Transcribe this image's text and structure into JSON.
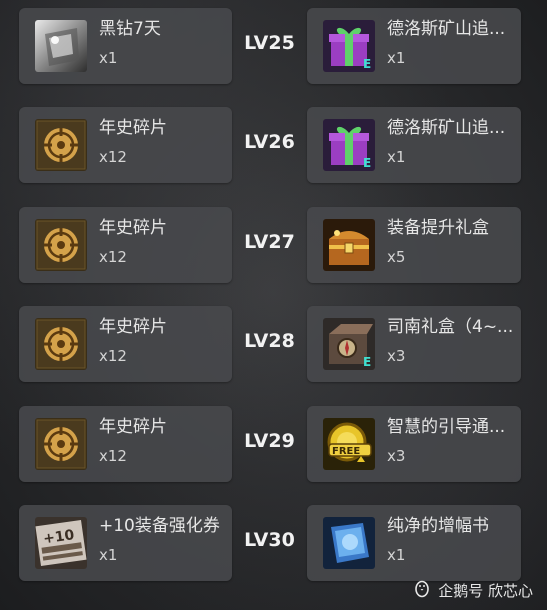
{
  "rows": [
    {
      "level": "LV25",
      "left": {
        "name": "黑钻7天",
        "qty": "x1",
        "icon": "black-diamond-icon"
      },
      "right": {
        "name": "德洛斯矿山追...",
        "qty": "x1",
        "icon": "gift-box-icon"
      }
    },
    {
      "level": "LV26",
      "left": {
        "name": "年史碎片",
        "qty": "x12",
        "icon": "chronicle-fragment-icon"
      },
      "right": {
        "name": "德洛斯矿山追...",
        "qty": "x1",
        "icon": "gift-box-icon"
      }
    },
    {
      "level": "LV27",
      "left": {
        "name": "年史碎片",
        "qty": "x12",
        "icon": "chronicle-fragment-icon"
      },
      "right": {
        "name": "装备提升礼盒",
        "qty": "x5",
        "icon": "treasure-chest-icon"
      }
    },
    {
      "level": "LV28",
      "left": {
        "name": "年史碎片",
        "qty": "x12",
        "icon": "chronicle-fragment-icon"
      },
      "right": {
        "name": "司南礼盒（4~...",
        "qty": "x3",
        "icon": "compass-box-icon"
      }
    },
    {
      "level": "LV29",
      "left": {
        "name": "年史碎片",
        "qty": "x12",
        "icon": "chronicle-fragment-icon"
      },
      "right": {
        "name": "智慧的引导通...",
        "qty": "x3",
        "icon": "free-pass-icon"
      }
    },
    {
      "level": "LV30",
      "left": {
        "name": "+10装备强化券",
        "qty": "x1",
        "icon": "enhance-ticket-icon"
      },
      "right": {
        "name": "纯净的增幅书",
        "qty": "x1",
        "icon": "amplify-book-icon"
      }
    }
  ],
  "watermark": {
    "text": "企鹅号 欣芯心",
    "icon": "penguin-icon"
  }
}
